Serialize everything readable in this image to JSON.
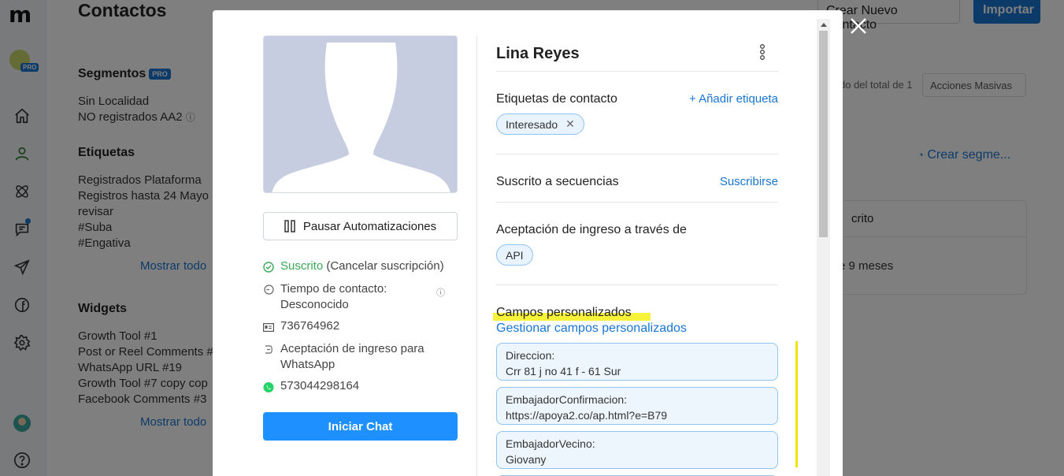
{
  "background": {
    "page_title": "Contactos",
    "segments": {
      "title": "Segmentos",
      "pro": "PRO",
      "items": [
        "Sin Localidad",
        "NO registrados AA2"
      ]
    },
    "tags": {
      "title": "Etiquetas",
      "items": [
        "Registrados Plataforma",
        "Registros hasta 24 Mayo",
        "revisar",
        "#Suba",
        "#Engativa"
      ],
      "show_all": "Mostrar todo"
    },
    "widgets": {
      "title": "Widgets",
      "items": [
        "Growth Tool #1",
        "Post or Reel Comments #",
        "WhatsApp URL #19",
        "Growth Tool #7 copy cop",
        "Facebook Comments #3"
      ],
      "show_all": "Mostrar todo"
    },
    "create_contact_button": "Crear Nuevo Contacto",
    "import_button": "Importar",
    "total_text": "do del total de 1",
    "bulk_actions": "Acciones Masivas",
    "create_segment": "Crear segme...",
    "table_header": "crito",
    "table_value": "e 9 meses",
    "rail_pro": "PRO"
  },
  "modal": {
    "pause_button": "Pausar Automatizaciones",
    "subscribed": "Suscrito",
    "unsubscribe": "(Cancelar suscripción)",
    "contact_time": "Tiempo de contacto: Desconocido",
    "id_number": "736764962",
    "acceptance_whatsapp": "Aceptación de ingreso para WhatsApp",
    "whatsapp_number": "573044298164",
    "start_chat": "Iniciar Chat",
    "contact_name": "Lina Reyes",
    "tags_label": "Etiquetas de contacto",
    "add_tag": "+ Añadir etiqueta",
    "tags": [
      "Interesado"
    ],
    "sequences_label": "Suscrito a secuencias",
    "subscribe_link": "Suscribirse",
    "acceptance_label": "Aceptación de ingreso a través de",
    "acceptance_chip": "API",
    "custom_fields_label": "Campos personalizados",
    "manage_fields": "Gestionar campos personalizados",
    "custom_fields": [
      {
        "name": "Direccion:",
        "value": "Crr 81 j no 41 f - 61 Sur"
      },
      {
        "name": "EmbajadorConfirmacion:",
        "value": "https://apoya2.co/ap.html?e=B79"
      },
      {
        "name": "EmbajadorVecino:",
        "value": "Giovany"
      }
    ]
  },
  "colors": {
    "accent": "#1976d2",
    "chat_button": "#1e90ff",
    "subscribed_green": "#3aa856",
    "highlight_yellow": "#f7f23a"
  }
}
